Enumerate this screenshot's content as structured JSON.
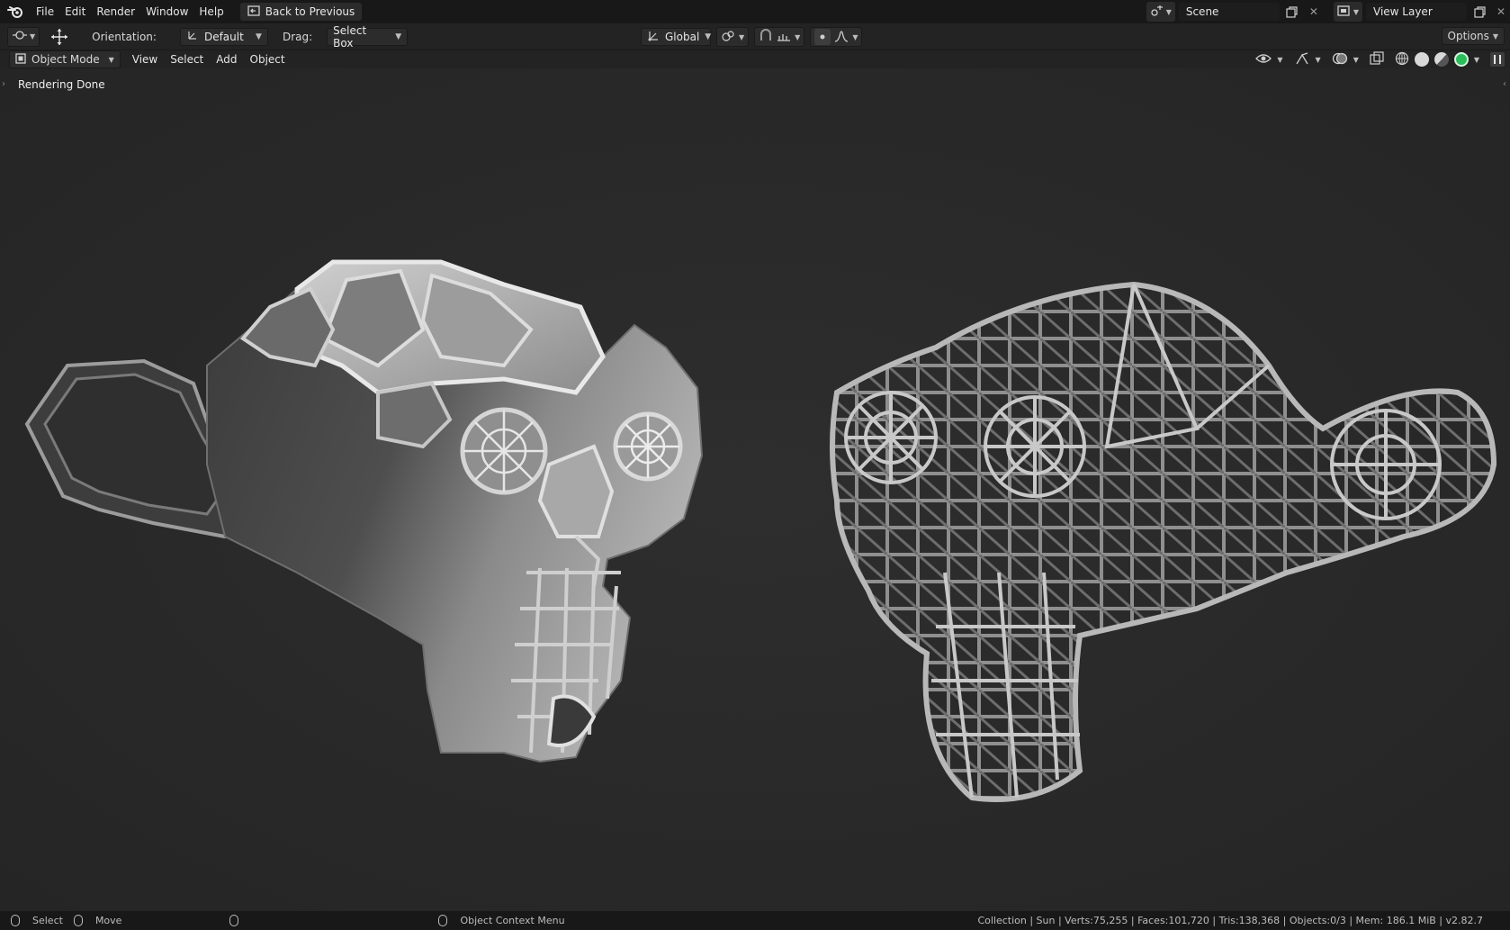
{
  "topbar": {
    "menus": [
      "File",
      "Edit",
      "Render",
      "Window",
      "Help"
    ],
    "back_label": "Back to Previous",
    "scene_value": "Scene",
    "view_layer_value": "View Layer"
  },
  "toolbar": {
    "orientation_label": "Orientation:",
    "orientation_value": "Default",
    "drag_label": "Drag:",
    "drag_value": "Select Box",
    "transform_orientation": "Global",
    "options_label": "Options"
  },
  "viewport_header": {
    "mode": "Object Mode",
    "menus": [
      "View",
      "Select",
      "Add",
      "Object"
    ]
  },
  "viewport": {
    "status_text": "Rendering Done"
  },
  "statusbar": {
    "select_label": "Select",
    "move_label": "Move",
    "context_menu_label": "Object Context Menu",
    "stats": "Collection | Sun | Verts:75,255 | Faces:101,720 | Tris:138,368 | Objects:0/3 | Mem: 186.1 MiB | v2.82.7"
  },
  "colors": {
    "accent_green": "#2bbd5a",
    "topbar_bg": "#181818",
    "viewport_bg": "#2b2b2b"
  },
  "icons": [
    "blender-logo-icon",
    "back-icon",
    "scene-icon",
    "view-layer-icon",
    "editor-type-icon",
    "move-tool-icon",
    "orientation-icon",
    "global-icon",
    "pivot-icon",
    "snap-icon",
    "proportional-icon",
    "visibility-icon",
    "gizmo-icon",
    "overlay-icon",
    "xray-icon",
    "wireframe-shading-icon",
    "solid-shading-icon",
    "material-shading-icon",
    "rendered-shading-icon",
    "mouse-left-icon",
    "mouse-middle-icon",
    "mouse-right-icon"
  ]
}
